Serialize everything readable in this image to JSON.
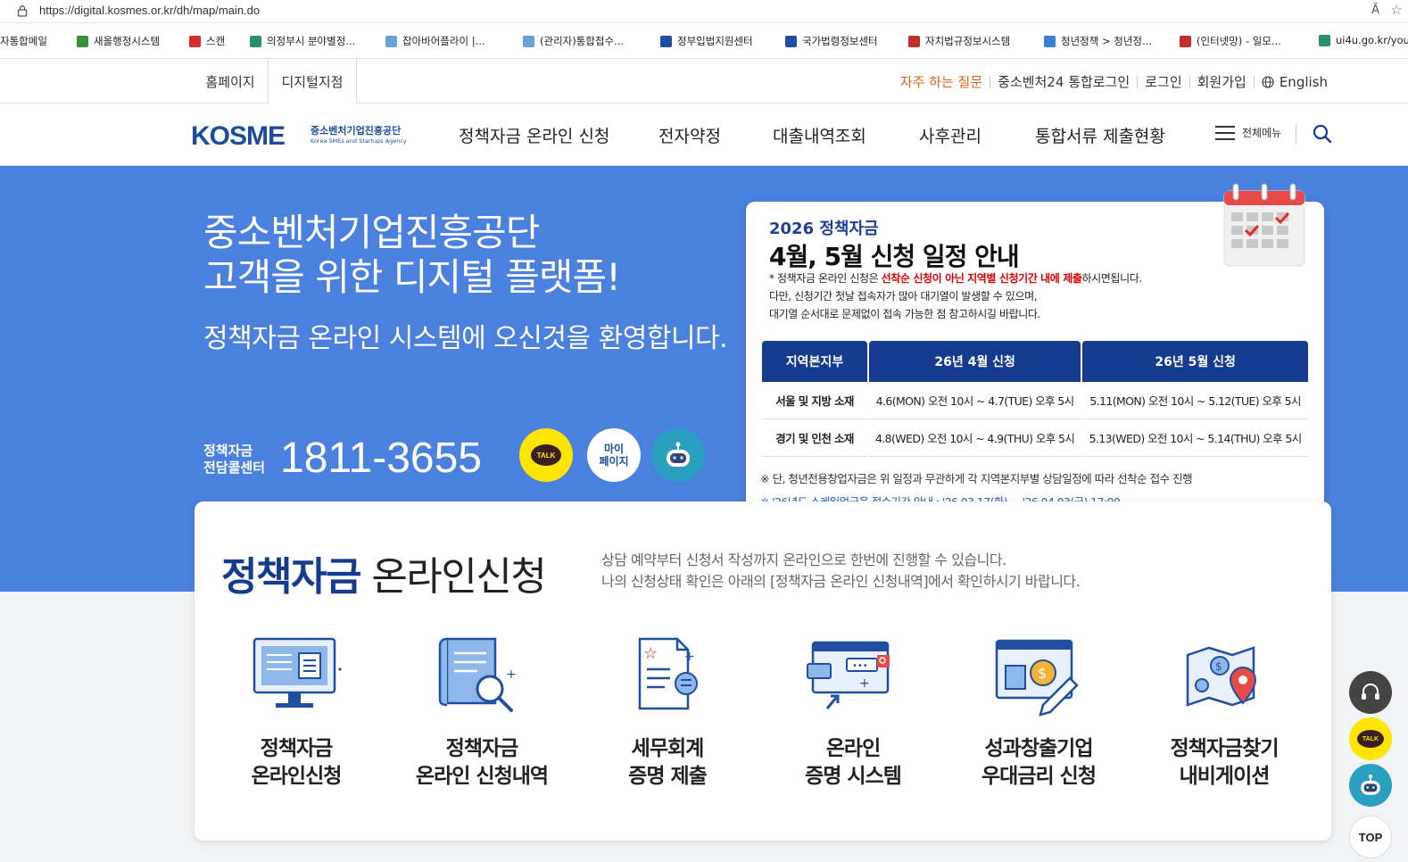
{
  "browser": {
    "url": "https://digital.kosmes.or.kr/dh/map/main.do",
    "read_aloud": "Ã",
    "bookmarks": [
      {
        "label": "자통합메일",
        "color": "#ffffff"
      },
      {
        "label": "새올행정시스템",
        "color": "#3a8f3a"
      },
      {
        "label": "스캔",
        "color": "#d62b2b"
      },
      {
        "label": "의정부시 분야별정...",
        "color": "#2a8f6a"
      },
      {
        "label": "잡아바어플라이 |...",
        "color": "#6aa0d8"
      },
      {
        "label": "(관리자)통합접수...",
        "color": "#6aa0d8"
      },
      {
        "label": "정부입법지원센터",
        "color": "#1f4f9e"
      },
      {
        "label": "국가법령정보센터",
        "color": "#1f4f9e"
      },
      {
        "label": "자치법규정보시스템",
        "color": "#c0302a"
      },
      {
        "label": "청년정책 > 청년정...",
        "color": "#3a7fd0"
      },
      {
        "label": "(인터넷망) - 일모...",
        "color": "#c0302a"
      },
      {
        "label": "ui4u.go.kr/you",
        "color": "#2a8f6a"
      }
    ]
  },
  "util": {
    "home": "홈페이지",
    "digital": "디지털지점",
    "faq": "자주 하는 질문",
    "login24": "중소벤처24 통합로그인",
    "login": "로그인",
    "join": "회원가입",
    "english": "English"
  },
  "gnb": {
    "logo_main": "KOSME",
    "logo_kr": "중소벤처기업진흥공단",
    "logo_en": "Korea SMEs and Startups Agency",
    "menu": [
      "정책자금 온라인 신청",
      "전자약정",
      "대출내역조회",
      "사후관리",
      "통합서류 제출현황"
    ],
    "allmenu": "전체메뉴"
  },
  "hero": {
    "line1": "중소벤처기업진흥공단",
    "line2": "고객을 위한 디지털 플랫폼!",
    "welcome": "정책자금 온라인 시스템에 오신것을 환영합니다.",
    "call_label1": "정책자금",
    "call_label2": "전담콜센터",
    "call_number": "1811-3655",
    "talk": "TALK",
    "mypage1": "마이",
    "mypage2": "페이지"
  },
  "notice": {
    "year": "2026 정책자금",
    "title": "4월, 5월 신청 일정 안내",
    "desc1_pre": "* 정책자금 온라인 신청은 ",
    "desc1_red": "선착순 신청이 아닌 지역별 신청기간 내에 제출",
    "desc1_post": "하시면됩니다.",
    "desc2": "다만, 신청기간 첫날 접속자가 많아 대기열이 발생할 수 있으며,",
    "desc3": "대기열 순서대로 문제없이 접속 가능한 점 참고하시길 바랍니다.",
    "headers": [
      "지역본지부",
      "26년 4월 신청",
      "26년 5월 신청"
    ],
    "rows": [
      [
        "서울 및 지방 소재",
        "4.6(MON) 오전 10시 ~ 4.7(TUE) 오후 5시",
        "5.11(MON) 오전 10시 ~ 5.12(TUE) 오후 5시"
      ],
      [
        "경기 및 인천 소재",
        "4.8(WED) 오전 10시 ~ 4.9(THU) 오후 5시",
        "5.13(WED) 오전 10시 ~ 5.14(THU) 오후 5시"
      ]
    ],
    "foot1": "※ 단, 청년전용창업자금은 위 일정과 무관하게 각 지역본지부별 상담일정에 따라 선착순 접수 진행",
    "foot2": "※ '26년도 스케일업금융 접수기간 안내 : '26.03.17(화) ~ '26.04.03(금) 17:00"
  },
  "main": {
    "title_bold": "정책자금",
    "title_light": "온라인신청",
    "sub1": "상담 예약부터 신청서 작성까지 온라인으로 한번에 진행할 수 있습니다.",
    "sub2": "나의 신청상태 확인은 아래의 [정책자금 온라인 신청내역]에서 확인하시기 바랍니다.",
    "services": [
      {
        "l1": "정책자금",
        "l2": "온라인신청",
        "icon": "monitor-icon"
      },
      {
        "l1": "정책자금",
        "l2": "온라인 신청내역",
        "icon": "document-search-icon"
      },
      {
        "l1": "세무회계",
        "l2": "증명 제출",
        "icon": "document-submit-icon"
      },
      {
        "l1": "온라인",
        "l2": "증명 시스템",
        "icon": "browser-certificate-icon"
      },
      {
        "l1": "성과창출기업",
        "l2": "우대금리 신청",
        "icon": "rate-pencil-icon"
      },
      {
        "l1": "정책자금찾기",
        "l2": "내비게이션",
        "icon": "map-pin-icon"
      }
    ]
  },
  "floating": {
    "talk": "TALK",
    "top": "TOP"
  },
  "colors": {
    "hero_blue": "#4a80de",
    "navy": "#153b8f",
    "faq_orange": "#e0621a",
    "kakao_yellow": "#fee500"
  }
}
